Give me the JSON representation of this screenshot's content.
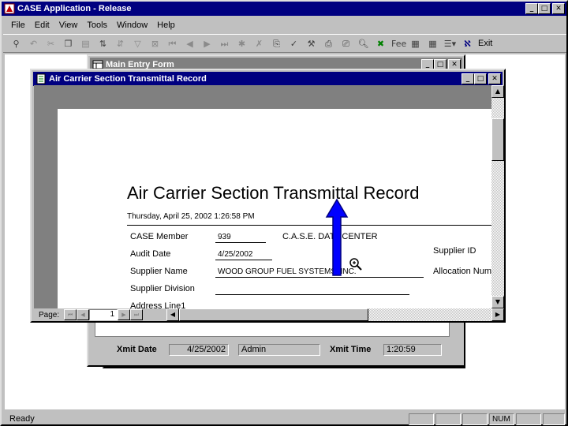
{
  "app": {
    "title": "CASE Application - Release",
    "menu": [
      "File",
      "Edit",
      "View",
      "Tools",
      "Window",
      "Help"
    ],
    "toolbar_last_label": "Exit",
    "status": {
      "text": "Ready",
      "num": "NUM"
    }
  },
  "main_form": {
    "title": "Main Entry Form",
    "xmit_date_label": "Xmit Date",
    "xmit_date_value": "4/25/2002",
    "xmit_user_value": "Admin",
    "xmit_time_label": "Xmit Time",
    "xmit_time_value": "1:20:59"
  },
  "report": {
    "title": "Air Carrier Section Transmittal Record",
    "heading": "Air Carrier Section Transmittal Record",
    "timestamp": "Thursday, April 25, 2002 1:26:58 PM",
    "fields": {
      "case_member_label": "CASE Member",
      "case_member_value": "939",
      "audit_date_label": "Audit Date",
      "audit_date_value": "4/25/2002",
      "supplier_name_label": "Supplier Name",
      "supplier_name_value": "WOOD GROUP FUEL SYSTEMS, INC.",
      "supplier_division_label": "Supplier Division",
      "address_line1_label": "Address Line1",
      "center_label": "C.A.S.E. DATA CENTER",
      "supplier_id_label": "Supplier ID",
      "allocation_label": "Allocation Num"
    },
    "nav": {
      "page_label": "Page:",
      "page_number": "1"
    }
  }
}
